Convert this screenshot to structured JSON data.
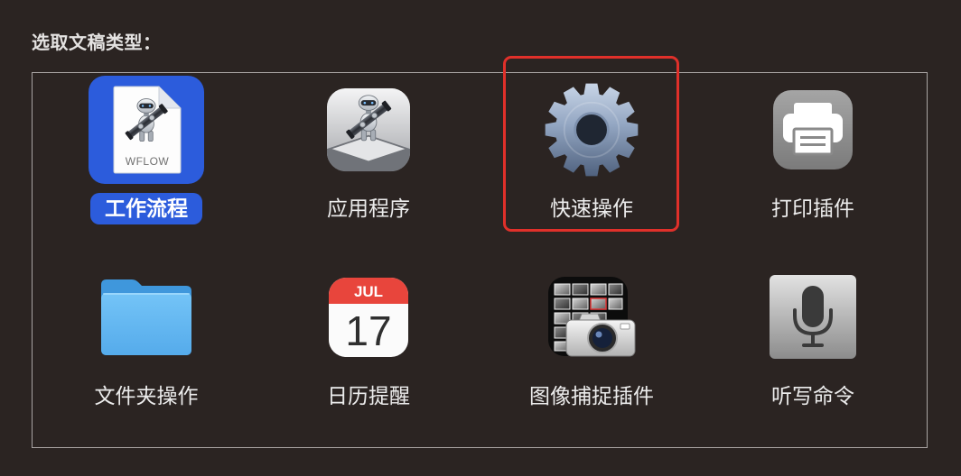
{
  "dialog": {
    "title": "选取文稿类型："
  },
  "document_types": [
    {
      "label": "工作流程",
      "icon": "workflow-document-icon",
      "icon_text": "WFLOW",
      "selected": true
    },
    {
      "label": "应用程序",
      "icon": "automator-robot-icon",
      "selected": false
    },
    {
      "label": "快速操作",
      "icon": "gear-icon",
      "selected": false,
      "highlighted": true
    },
    {
      "label": "打印插件",
      "icon": "printer-icon",
      "selected": false
    },
    {
      "label": "文件夹操作",
      "icon": "folder-icon",
      "selected": false
    },
    {
      "label": "日历提醒",
      "icon": "calendar-icon",
      "icon_month": "JUL",
      "icon_day": "17",
      "selected": false
    },
    {
      "label": "图像捕捉插件",
      "icon": "image-capture-camera-icon",
      "selected": false
    },
    {
      "label": "听写命令",
      "icon": "microphone-icon",
      "selected": false
    }
  ],
  "colors": {
    "window_background": "#2b2422",
    "selection": "#2c5cdc",
    "highlight_annotation": "#e0302a",
    "label_text": "#ececec",
    "frame_border": "#a9a4a3"
  }
}
